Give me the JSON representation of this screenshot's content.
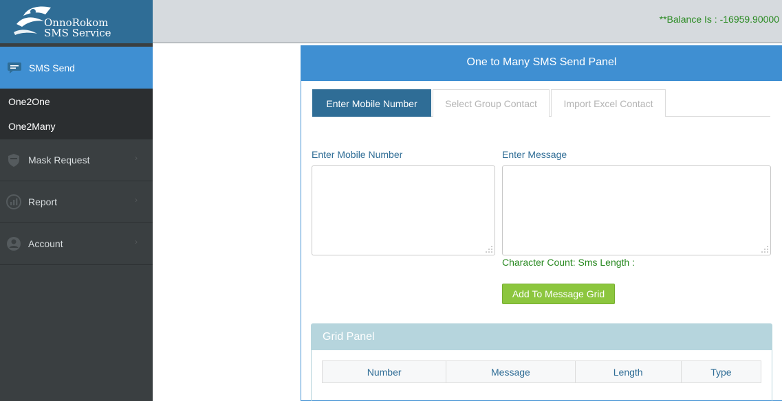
{
  "brand": {
    "line1": "OnnoRokom",
    "line2": "SMS Service",
    "logo_icon": "bird-book-logo-icon"
  },
  "header": {
    "balance": "**Balance Is : -16959.90000"
  },
  "sidebar": {
    "active": {
      "label": "SMS Send",
      "icon": "chat-icon"
    },
    "submenu": [
      "One2One",
      "One2Many"
    ],
    "items": [
      {
        "label": "Mask Request",
        "icon": "shield-icon"
      },
      {
        "label": "Report",
        "icon": "chart-icon"
      },
      {
        "label": "Account",
        "icon": "user-icon"
      }
    ]
  },
  "panel": {
    "title": "One to Many SMS Send Panel",
    "tabs": [
      "Enter Mobile Number",
      "Select Group Contact",
      "Import Excel Contact"
    ],
    "active_tab": "Enter Mobile Number",
    "mobile_label": "Enter Mobile Number",
    "message_label": "Enter Message",
    "mobile_value": "",
    "message_value": "",
    "char_count": "Character Count: Sms Length :",
    "add_button": "Add To Message Grid"
  },
  "grid": {
    "title": "Grid Panel",
    "columns": [
      "Number",
      "Message",
      "Length",
      "Type"
    ]
  },
  "colors": {
    "primary": "#3f8fd2",
    "dark_blue": "#2f6d96",
    "sidebar": "#3a3f41",
    "green_text": "#2a8a22",
    "button_green": "#8cc63e",
    "grid_header": "#b6d5dd"
  }
}
